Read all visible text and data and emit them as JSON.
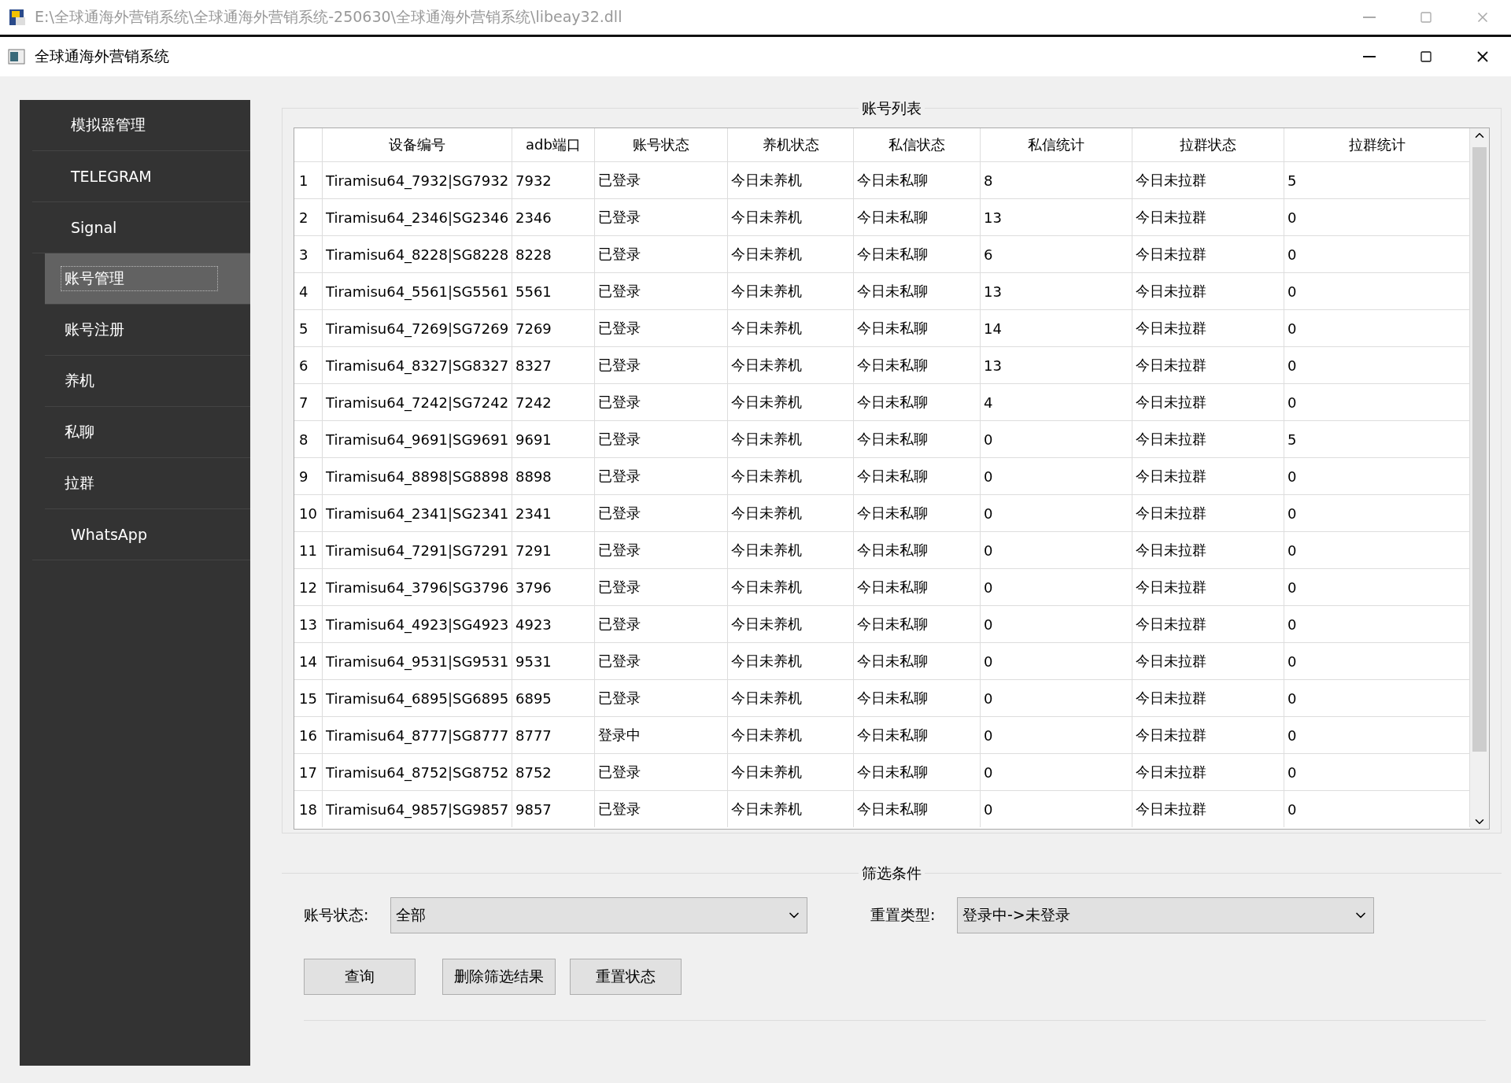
{
  "outer_window": {
    "title": "E:\\全球通海外营销系统\\全球通海外营销系统-250630\\全球通海外营销系统\\libeay32.dll"
  },
  "window": {
    "title": "全球通海外营销系统"
  },
  "sidebar": {
    "items": [
      {
        "label": "模拟器管理",
        "selected": false
      },
      {
        "label": "TELEGRAM",
        "selected": false
      },
      {
        "label": "Signal",
        "selected": false,
        "children": [
          {
            "label": "账号管理",
            "selected": true
          },
          {
            "label": "账号注册",
            "selected": false
          },
          {
            "label": "养机",
            "selected": false
          },
          {
            "label": "私聊",
            "selected": false
          },
          {
            "label": "拉群",
            "selected": false
          }
        ]
      },
      {
        "label": "WhatsApp",
        "selected": false
      }
    ]
  },
  "account_list": {
    "title": "账号列表",
    "columns": [
      "",
      "设备编号",
      "adb端口",
      "账号状态",
      "养机状态",
      "私信状态",
      "私信统计",
      "拉群状态",
      "拉群统计"
    ],
    "rows": [
      [
        "1",
        "Tiramisu64_7932|SG7932",
        "7932",
        "已登录",
        "今日未养机",
        "今日未私聊",
        "8",
        "今日未拉群",
        "5"
      ],
      [
        "2",
        "Tiramisu64_2346|SG2346",
        "2346",
        "已登录",
        "今日未养机",
        "今日未私聊",
        "13",
        "今日未拉群",
        "0"
      ],
      [
        "3",
        "Tiramisu64_8228|SG8228",
        "8228",
        "已登录",
        "今日未养机",
        "今日未私聊",
        "6",
        "今日未拉群",
        "0"
      ],
      [
        "4",
        "Tiramisu64_5561|SG5561",
        "5561",
        "已登录",
        "今日未养机",
        "今日未私聊",
        "13",
        "今日未拉群",
        "0"
      ],
      [
        "5",
        "Tiramisu64_7269|SG7269",
        "7269",
        "已登录",
        "今日未养机",
        "今日未私聊",
        "14",
        "今日未拉群",
        "0"
      ],
      [
        "6",
        "Tiramisu64_8327|SG8327",
        "8327",
        "已登录",
        "今日未养机",
        "今日未私聊",
        "13",
        "今日未拉群",
        "0"
      ],
      [
        "7",
        "Tiramisu64_7242|SG7242",
        "7242",
        "已登录",
        "今日未养机",
        "今日未私聊",
        "4",
        "今日未拉群",
        "0"
      ],
      [
        "8",
        "Tiramisu64_9691|SG9691",
        "9691",
        "已登录",
        "今日未养机",
        "今日未私聊",
        "0",
        "今日未拉群",
        "5"
      ],
      [
        "9",
        "Tiramisu64_8898|SG8898",
        "8898",
        "已登录",
        "今日未养机",
        "今日未私聊",
        "0",
        "今日未拉群",
        "0"
      ],
      [
        "10",
        "Tiramisu64_2341|SG2341",
        "2341",
        "已登录",
        "今日未养机",
        "今日未私聊",
        "0",
        "今日未拉群",
        "0"
      ],
      [
        "11",
        "Tiramisu64_7291|SG7291",
        "7291",
        "已登录",
        "今日未养机",
        "今日未私聊",
        "0",
        "今日未拉群",
        "0"
      ],
      [
        "12",
        "Tiramisu64_3796|SG3796",
        "3796",
        "已登录",
        "今日未养机",
        "今日未私聊",
        "0",
        "今日未拉群",
        "0"
      ],
      [
        "13",
        "Tiramisu64_4923|SG4923",
        "4923",
        "已登录",
        "今日未养机",
        "今日未私聊",
        "0",
        "今日未拉群",
        "0"
      ],
      [
        "14",
        "Tiramisu64_9531|SG9531",
        "9531",
        "已登录",
        "今日未养机",
        "今日未私聊",
        "0",
        "今日未拉群",
        "0"
      ],
      [
        "15",
        "Tiramisu64_6895|SG6895",
        "6895",
        "已登录",
        "今日未养机",
        "今日未私聊",
        "0",
        "今日未拉群",
        "0"
      ],
      [
        "16",
        "Tiramisu64_8777|SG8777",
        "8777",
        "登录中",
        "今日未养机",
        "今日未私聊",
        "0",
        "今日未拉群",
        "0"
      ],
      [
        "17",
        "Tiramisu64_8752|SG8752",
        "8752",
        "已登录",
        "今日未养机",
        "今日未私聊",
        "0",
        "今日未拉群",
        "0"
      ],
      [
        "18",
        "Tiramisu64_9857|SG9857",
        "9857",
        "已登录",
        "今日未养机",
        "今日未私聊",
        "0",
        "今日未拉群",
        "0"
      ]
    ]
  },
  "filter": {
    "title": "筛选条件",
    "fields": [
      {
        "label": "账号状态:",
        "value": "全部"
      },
      {
        "label": "重置类型:",
        "value": "登录中->未登录"
      }
    ],
    "buttons": [
      "查询",
      "删除筛选结果",
      "重置状态"
    ]
  }
}
